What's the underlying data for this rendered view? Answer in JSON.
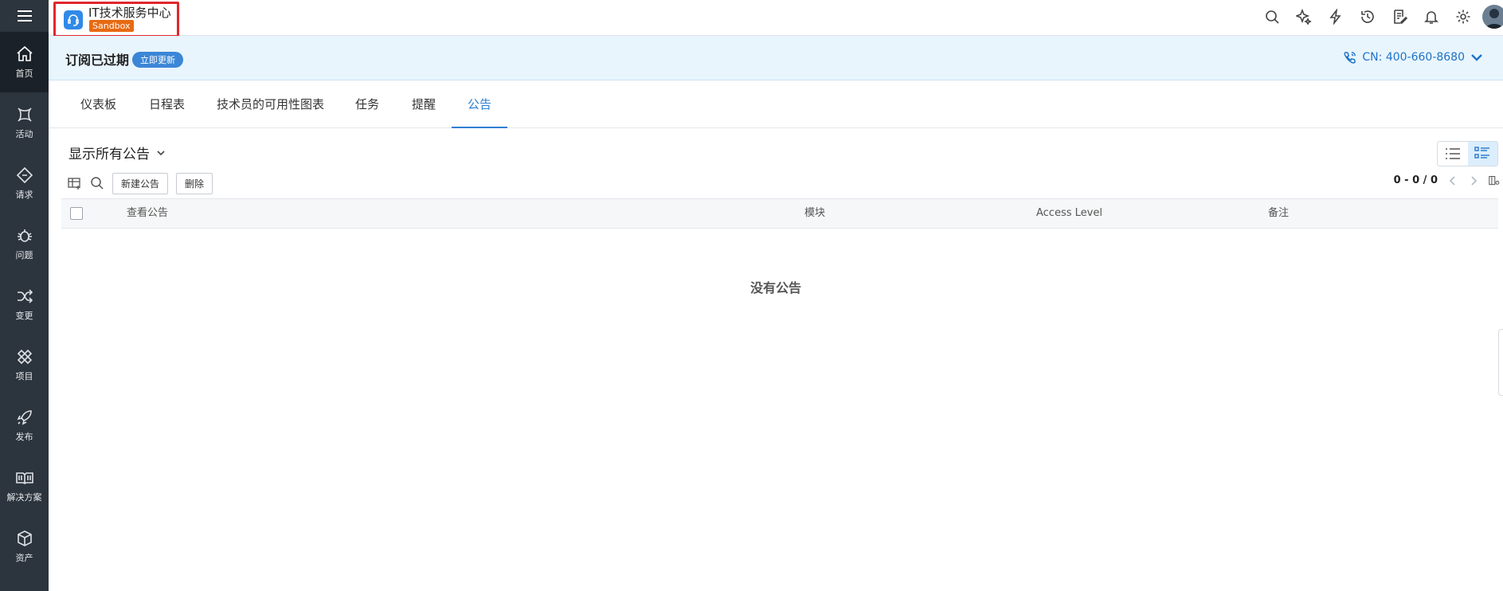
{
  "app": {
    "title": "IT技术服务中心",
    "badge": "Sandbox"
  },
  "sidebar": {
    "items": [
      {
        "label": "首页",
        "icon": "home-icon"
      },
      {
        "label": "活动",
        "icon": "activity-icon"
      },
      {
        "label": "请求",
        "icon": "request-icon"
      },
      {
        "label": "问题",
        "icon": "problem-bug-icon"
      },
      {
        "label": "变更",
        "icon": "shuffle-change-icon"
      },
      {
        "label": "项目",
        "icon": "project-icon"
      },
      {
        "label": "发布",
        "icon": "rocket-release-icon"
      },
      {
        "label": "解决方案",
        "icon": "book-solution-icon"
      },
      {
        "label": "资产",
        "icon": "cube-asset-icon"
      }
    ]
  },
  "topbar": {
    "icons": [
      "search-icon",
      "spark-icon",
      "lightning-icon",
      "history-icon",
      "notes-icon",
      "bell-icon",
      "gear-icon",
      "avatar"
    ]
  },
  "banner": {
    "title": "订阅已过期",
    "renew_label": "立即更新",
    "phone": "CN: 400-660-8680"
  },
  "tabs": [
    {
      "label": "仪表板"
    },
    {
      "label": "日程表"
    },
    {
      "label": "技术员的可用性图表"
    },
    {
      "label": "任务"
    },
    {
      "label": "提醒"
    },
    {
      "label": "公告",
      "active": true
    }
  ],
  "content": {
    "view_label": "显示所有公告",
    "new_button": "新建公告",
    "delete_button": "删除",
    "pager": "0 - 0 / 0",
    "columns": [
      "查看公告",
      "模块",
      "Access Level",
      "备注"
    ],
    "empty_text": "没有公告"
  },
  "colors": {
    "accent": "#2f7fd2",
    "sidebar": "#2c343d",
    "banner": "#e8f5fd",
    "sandbox": "#e86a12",
    "highlight": "#e0262b"
  }
}
